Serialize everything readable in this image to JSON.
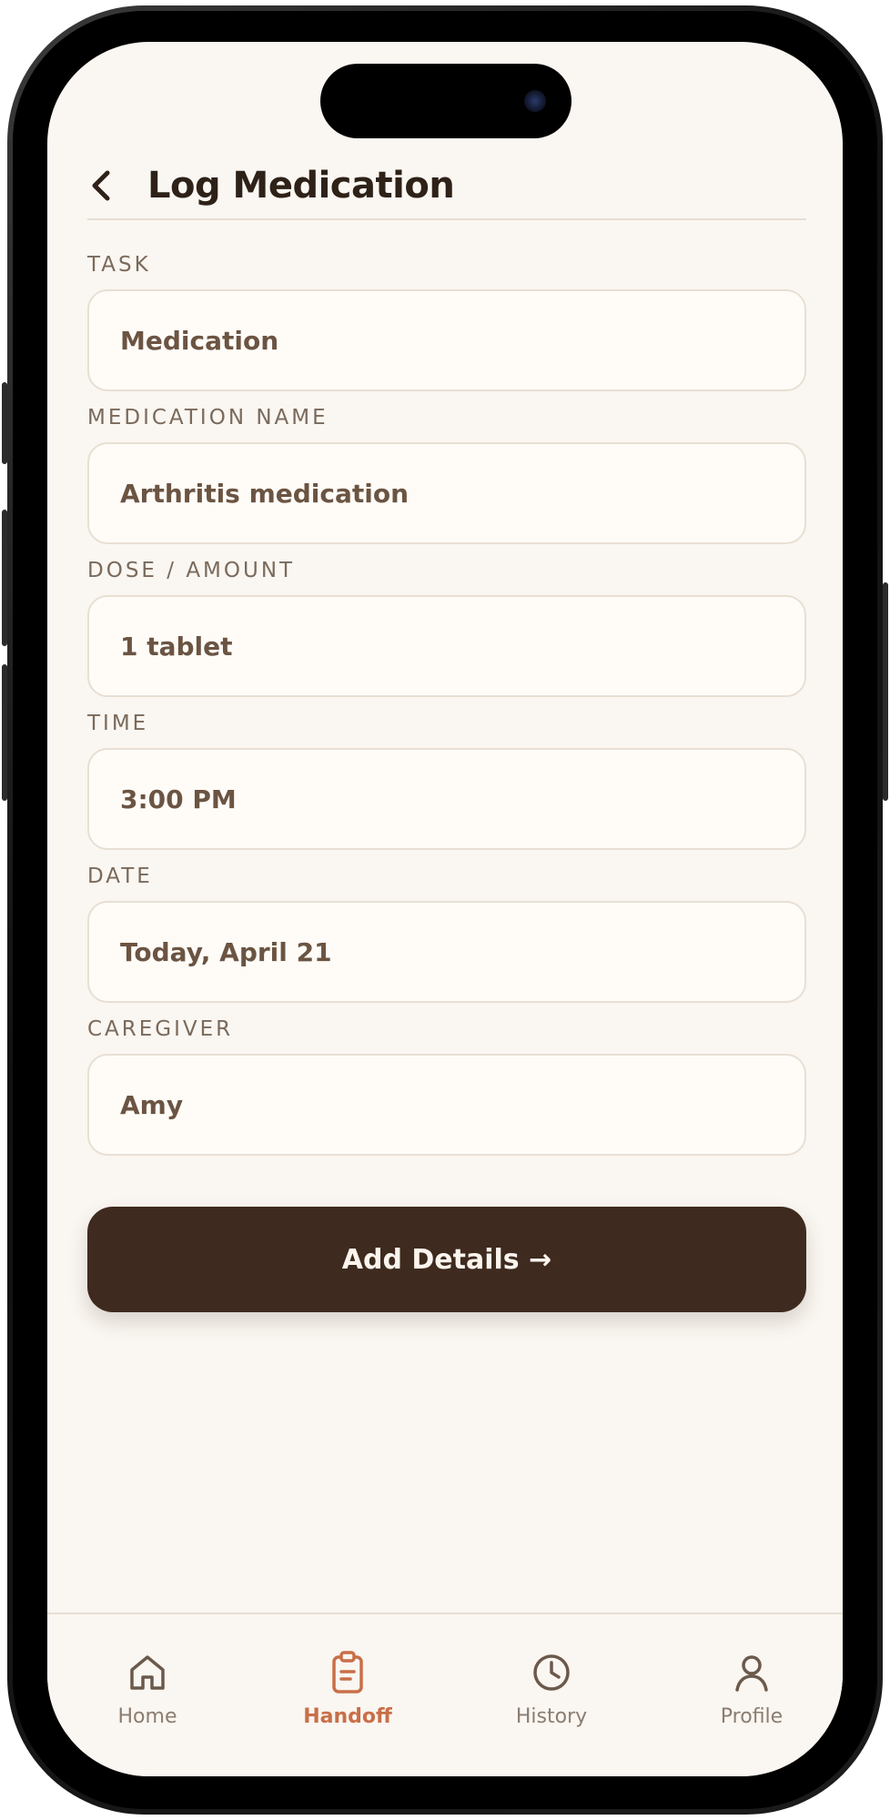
{
  "header": {
    "title": "Log Medication",
    "back_icon": "chevron-left-icon"
  },
  "form": {
    "fields": [
      {
        "label": "TASK",
        "value": "Medication"
      },
      {
        "label": "MEDICATION NAME",
        "value": "Arthritis medication"
      },
      {
        "label": "DOSE / AMOUNT",
        "value": "1 tablet"
      },
      {
        "label": "TIME",
        "value": "3:00 PM"
      },
      {
        "label": "DATE",
        "value": "Today, April 21"
      },
      {
        "label": "CAREGIVER",
        "value": "Amy"
      }
    ]
  },
  "primary_action": {
    "label": "Add Details →"
  },
  "tab_bar": {
    "active": "Handoff",
    "items": [
      {
        "label": "Home",
        "icon": "home-icon"
      },
      {
        "label": "Handoff",
        "icon": "clipboard-icon"
      },
      {
        "label": "History",
        "icon": "clock-icon"
      },
      {
        "label": "Profile",
        "icon": "user-icon"
      }
    ]
  },
  "colors": {
    "background": "#faf6f1",
    "primary_button": "#3e2a1e",
    "accent": "#c96f48",
    "text_dark": "#2e2118",
    "label_text": "#7a6a5c",
    "field_text": "#6b5442",
    "inactive_tab": "#8b7d70"
  }
}
